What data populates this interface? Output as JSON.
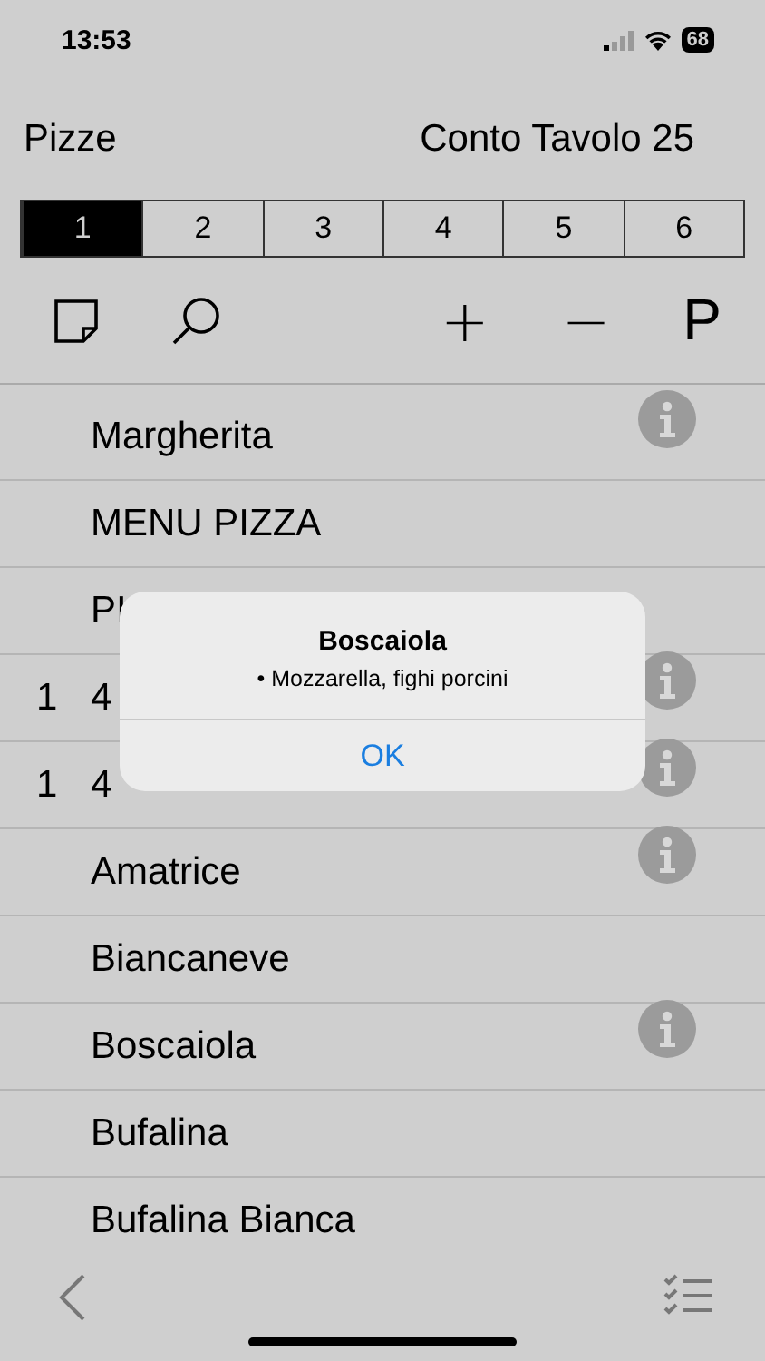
{
  "status_bar": {
    "time": "13:53",
    "battery": "68"
  },
  "header": {
    "title": "Pizze",
    "table": "Conto Tavolo 25"
  },
  "tabs": [
    {
      "label": "1",
      "selected": true
    },
    {
      "label": "2",
      "selected": false
    },
    {
      "label": "3",
      "selected": false
    },
    {
      "label": "4",
      "selected": false
    },
    {
      "label": "5",
      "selected": false
    },
    {
      "label": "6",
      "selected": false
    }
  ],
  "toolbar": {
    "plus": "+",
    "minus": "−",
    "p": "P"
  },
  "items": [
    {
      "label": "Margherita",
      "info": true
    },
    {
      "label": "MENU PIZZA",
      "info": false
    },
    {
      "label": "PI",
      "info": false
    },
    {
      "qty": "1",
      "label": "4",
      "info": true
    },
    {
      "qty": "1",
      "label": "4",
      "info": true
    },
    {
      "label": "Amatrice",
      "info": true
    },
    {
      "label": "Biancaneve",
      "info": false
    },
    {
      "label": "Boscaiola",
      "info": true
    },
    {
      "label": "Bufalina",
      "info": false
    },
    {
      "label": "Bufalina Bianca",
      "info": false
    }
  ],
  "alert": {
    "title": "Boscaiola",
    "message": "• Mozzarella, fighi porcini",
    "button": "OK"
  }
}
